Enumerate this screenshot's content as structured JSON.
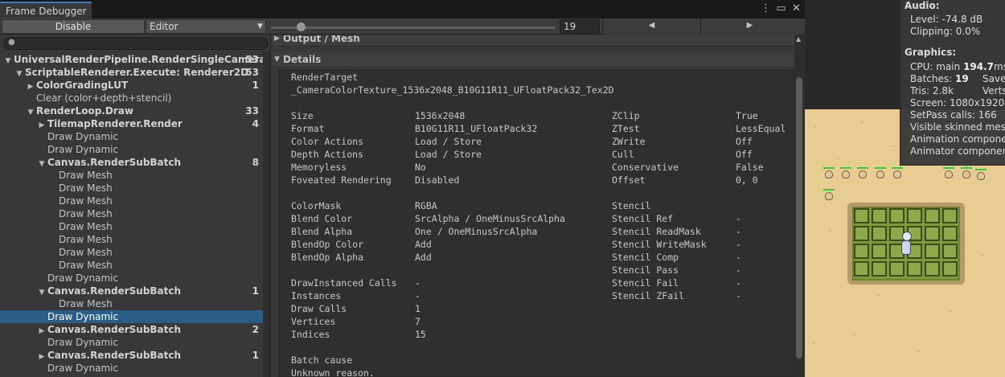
{
  "window": {
    "tab_title": "Frame Debugger",
    "icons": [
      "more-vert-icon",
      "maximize-icon",
      "close-icon"
    ]
  },
  "toolbar": {
    "disable_label": "Disable",
    "target_value": "Editor",
    "frame_value": "19",
    "prev_icon": "◀",
    "next_icon": "▶"
  },
  "search": {
    "placeholder": ""
  },
  "tree": [
    {
      "label": "UniversalRenderPipeline.RenderSingleCameraInt",
      "count": "53",
      "depth": 0,
      "arrow": "▼",
      "bold": true
    },
    {
      "label": "ScriptableRenderer.Execute: Renderer2D",
      "count": "53",
      "depth": 1,
      "arrow": "▼",
      "bold": true
    },
    {
      "label": "ColorGradingLUT",
      "count": "1",
      "depth": 2,
      "arrow": "▶",
      "bold": true
    },
    {
      "label": "Clear (color+depth+stencil)",
      "count": "",
      "depth": 2,
      "arrow": "",
      "bold": false
    },
    {
      "label": "RenderLoop.Draw",
      "count": "33",
      "depth": 2,
      "arrow": "▼",
      "bold": true
    },
    {
      "label": "TilemapRenderer.Render",
      "count": "4",
      "depth": 3,
      "arrow": "▶",
      "bold": true
    },
    {
      "label": "Draw Dynamic",
      "count": "",
      "depth": 3,
      "arrow": "",
      "bold": false
    },
    {
      "label": "Draw Dynamic",
      "count": "",
      "depth": 3,
      "arrow": "",
      "bold": false
    },
    {
      "label": "Canvas.RenderSubBatch",
      "count": "8",
      "depth": 3,
      "arrow": "▼",
      "bold": true
    },
    {
      "label": "Draw Mesh",
      "count": "",
      "depth": 4,
      "arrow": "",
      "bold": false
    },
    {
      "label": "Draw Mesh",
      "count": "",
      "depth": 4,
      "arrow": "",
      "bold": false
    },
    {
      "label": "Draw Mesh",
      "count": "",
      "depth": 4,
      "arrow": "",
      "bold": false
    },
    {
      "label": "Draw Mesh",
      "count": "",
      "depth": 4,
      "arrow": "",
      "bold": false
    },
    {
      "label": "Draw Mesh",
      "count": "",
      "depth": 4,
      "arrow": "",
      "bold": false
    },
    {
      "label": "Draw Mesh",
      "count": "",
      "depth": 4,
      "arrow": "",
      "bold": false
    },
    {
      "label": "Draw Mesh",
      "count": "",
      "depth": 4,
      "arrow": "",
      "bold": false
    },
    {
      "label": "Draw Mesh",
      "count": "",
      "depth": 4,
      "arrow": "",
      "bold": false
    },
    {
      "label": "Draw Dynamic",
      "count": "",
      "depth": 3,
      "arrow": "",
      "bold": false
    },
    {
      "label": "Canvas.RenderSubBatch",
      "count": "1",
      "depth": 3,
      "arrow": "▼",
      "bold": true
    },
    {
      "label": "Draw Mesh",
      "count": "",
      "depth": 4,
      "arrow": "",
      "bold": false
    },
    {
      "label": "Draw Dynamic",
      "count": "",
      "depth": 3,
      "arrow": "",
      "bold": false,
      "selected": true
    },
    {
      "label": "Canvas.RenderSubBatch",
      "count": "2",
      "depth": 3,
      "arrow": "▶",
      "bold": true
    },
    {
      "label": "Draw Dynamic",
      "count": "",
      "depth": 3,
      "arrow": "",
      "bold": false
    },
    {
      "label": "Canvas.RenderSubBatch",
      "count": "1",
      "depth": 3,
      "arrow": "▶",
      "bold": true
    },
    {
      "label": "Draw Dynamic",
      "count": "",
      "depth": 3,
      "arrow": "",
      "bold": false
    }
  ],
  "sections": {
    "output_mesh": "Output / Mesh",
    "details": "Details"
  },
  "details": {
    "render_target_label": "RenderTarget",
    "render_target_value": "_CameraColorTexture_1536x2048_B10G11R11_UFloatPack32_Tex2D",
    "left_props": [
      [
        "Size",
        "1536x2048"
      ],
      [
        "Format",
        "B10G11R11_UFloatPack32"
      ],
      [
        "Color Actions",
        "Load / Store"
      ],
      [
        "Depth Actions",
        "Load / Store"
      ],
      [
        "Memoryless",
        "No"
      ],
      [
        "Foveated Rendering",
        "Disabled"
      ],
      [
        "",
        ""
      ],
      [
        "ColorMask",
        "RGBA"
      ],
      [
        "Blend Color",
        "SrcAlpha / OneMinusSrcAlpha"
      ],
      [
        "Blend Alpha",
        "One / OneMinusSrcAlpha"
      ],
      [
        "BlendOp Color",
        "Add"
      ],
      [
        "BlendOp Alpha",
        "Add"
      ],
      [
        "",
        ""
      ],
      [
        "DrawInstanced Calls",
        "-"
      ],
      [
        "Instances",
        "-"
      ],
      [
        "Draw Calls",
        "1"
      ],
      [
        "Vertices",
        "7"
      ],
      [
        "Indices",
        "15"
      ],
      [
        "",
        ""
      ],
      [
        "Batch cause",
        ""
      ],
      [
        "Unknown reason.",
        ""
      ]
    ],
    "right_props": [
      [
        "ZClip",
        "True"
      ],
      [
        "ZTest",
        "LessEqual"
      ],
      [
        "ZWrite",
        "Off"
      ],
      [
        "Cull",
        "Off"
      ],
      [
        "Conservative",
        "False"
      ],
      [
        "Offset",
        "0, 0"
      ],
      [
        "",
        ""
      ],
      [
        "Stencil",
        ""
      ],
      [
        "Stencil Ref",
        "-"
      ],
      [
        "Stencil ReadMask",
        "-"
      ],
      [
        "Stencil WriteMask",
        "-"
      ],
      [
        "Stencil Comp",
        "-"
      ],
      [
        "Stencil Pass",
        "-"
      ],
      [
        "Stencil Fail",
        "-"
      ],
      [
        "Stencil ZFail",
        "-"
      ]
    ]
  },
  "stats": {
    "audio_header": "Audio:",
    "level": "Level: -74.8 dB",
    "clipping": "Clipping: 0.0%",
    "graphics_header": "Graphics:",
    "cpu_prefix": "CPU: main ",
    "cpu_value": "194.7",
    "cpu_suffix": "ms  r",
    "batches_prefix": "Batches: ",
    "batches_value": "19",
    "batches_extra": "Save",
    "tris": "Tris: 2.8k",
    "tris_extra": "Verts",
    "screen": "Screen: 1080x1920 -",
    "setpass": "SetPass calls: 166",
    "skinned": "Visible skinned meshe",
    "animation": "Animation componen",
    "animator": "Animator components"
  },
  "game": {
    "sand_color": "#e8cd92",
    "grass_color": "#7f9a3c"
  }
}
